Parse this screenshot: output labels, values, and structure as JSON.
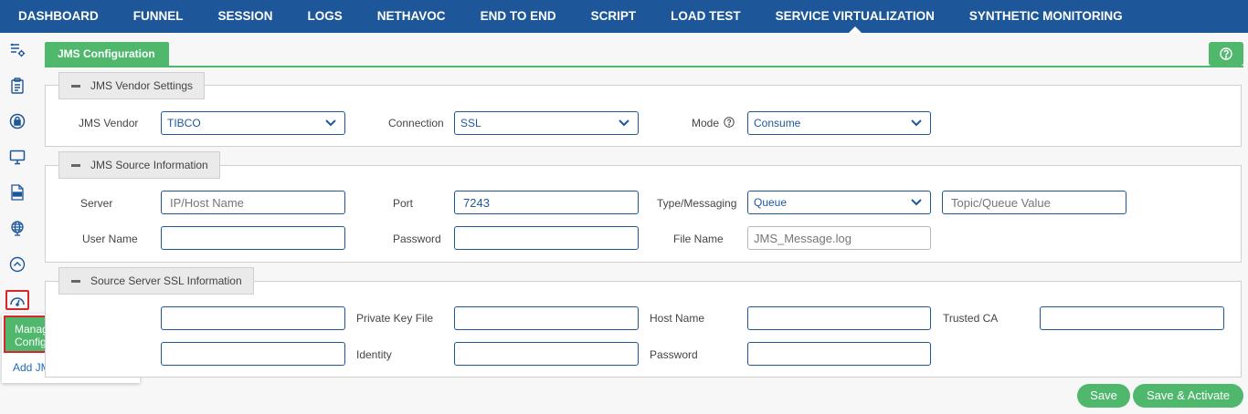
{
  "nav": {
    "tabs": [
      "DASHBOARD",
      "FUNNEL",
      "SESSION",
      "LOGS",
      "NETHAVOC",
      "END TO END",
      "SCRIPT",
      "LOAD TEST",
      "SERVICE VIRTUALIZATION",
      "SYNTHETIC MONITORING"
    ],
    "active": "SERVICE VIRTUALIZATION"
  },
  "rail": {
    "icons": [
      "list-settings-icon",
      "clipboard-icon",
      "lock-icon",
      "monitor-icon",
      "log-file-icon",
      "globe-icon",
      "chevron-up-circle-icon",
      "gauge-icon"
    ],
    "active": "gauge-icon"
  },
  "flyout": {
    "items": [
      "Manage JMS Configuration",
      "Add JMS Configuration"
    ]
  },
  "panel": {
    "tab_label": "JMS Configuration",
    "help_icon": "help-circle-icon"
  },
  "vendor": {
    "legend": "JMS Vendor Settings",
    "vendor_label": "JMS Vendor",
    "vendor_value": "TIBCO",
    "connection_label": "Connection",
    "connection_value": "SSL",
    "mode_label": "Mode",
    "mode_value": "Consume"
  },
  "source": {
    "legend": "JMS Source Information",
    "server_label": "Server",
    "server_placeholder": "IP/Host Name",
    "port_label": "Port",
    "port_value": "7243",
    "type_label": "Type/Messaging",
    "type_value": "Queue",
    "topic_placeholder": "Topic/Queue Value",
    "username_label": "User Name",
    "password_label": "Password",
    "filename_label": "File Name",
    "filename_placeholder": "JMS_Message.log"
  },
  "ssl": {
    "legend": "Source Server SSL Information",
    "private_key_label": "Private Key File",
    "host_name_label": "Host Name",
    "trusted_ca_label": "Trusted CA",
    "identity_label": "Identity",
    "password_label": "Password"
  },
  "buttons": {
    "save": "Save",
    "save_activate": "Save & Activate"
  },
  "colors": {
    "nav_bg": "#1e5799",
    "accent_green": "#4fb86c",
    "highlight_red": "#d9262c"
  }
}
